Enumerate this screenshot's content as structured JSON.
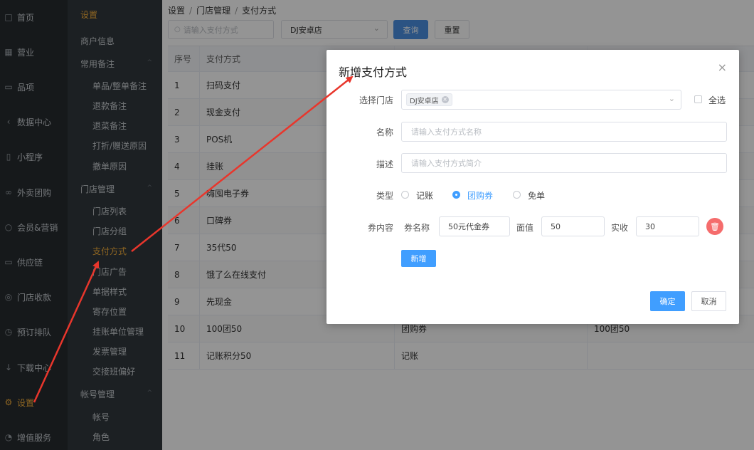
{
  "nav_primary": [
    {
      "icon": "home-icon",
      "glyph": "□",
      "label": "首页"
    },
    {
      "icon": "calendar-icon",
      "glyph": "▦",
      "label": "营业"
    },
    {
      "icon": "bag-icon",
      "glyph": "▭",
      "label": "品项"
    },
    {
      "icon": "share-icon",
      "glyph": "‹",
      "label": "数据中心"
    },
    {
      "icon": "phone-icon",
      "glyph": "▯",
      "label": "小程序"
    },
    {
      "icon": "bike-icon",
      "glyph": "∞",
      "label": "外卖团购"
    },
    {
      "icon": "user-icon",
      "glyph": "○",
      "label": "会员&营销"
    },
    {
      "icon": "truck-icon",
      "glyph": "▭",
      "label": "供应链"
    },
    {
      "icon": "database-icon",
      "glyph": "◎",
      "label": "门店收款"
    },
    {
      "icon": "clock-icon",
      "glyph": "◷",
      "label": "预订排队"
    },
    {
      "icon": "download-icon",
      "glyph": "↓",
      "label": "下载中心"
    },
    {
      "icon": "gear-icon",
      "glyph": "⚙",
      "label": "设置"
    },
    {
      "icon": "alarm-icon",
      "glyph": "◔",
      "label": "增值服务"
    }
  ],
  "nav_secondary": {
    "title": "设置",
    "items": [
      {
        "label": "商户信息",
        "level": 1
      },
      {
        "label": "常用备注",
        "level": 1,
        "caret": "^"
      },
      {
        "label": "单品/整单备注",
        "level": 2
      },
      {
        "label": "退款备注",
        "level": 2
      },
      {
        "label": "退菜备注",
        "level": 2
      },
      {
        "label": "打折/赠送原因",
        "level": 2
      },
      {
        "label": "撤单原因",
        "level": 2
      },
      {
        "label": "门店管理",
        "level": 1,
        "caret": "^"
      },
      {
        "label": "门店列表",
        "level": 2
      },
      {
        "label": "门店分组",
        "level": 2
      },
      {
        "label": "支付方式",
        "level": 2,
        "active": true
      },
      {
        "label": "门店广告",
        "level": 2
      },
      {
        "label": "单据样式",
        "level": 2
      },
      {
        "label": "寄存位置",
        "level": 2
      },
      {
        "label": "挂账单位管理",
        "level": 2
      },
      {
        "label": "发票管理",
        "level": 2
      },
      {
        "label": "交接班偏好",
        "level": 2
      },
      {
        "label": "帐号管理",
        "level": 1,
        "caret": "^"
      },
      {
        "label": "帐号",
        "level": 2
      },
      {
        "label": "角色",
        "level": 2
      }
    ]
  },
  "breadcrumb": [
    "设置",
    "门店管理",
    "支付方式"
  ],
  "toolbar": {
    "search_placeholder": "请输入支付方式",
    "store_value": "DJ安卓店",
    "query_label": "查询",
    "reset_label": "重置"
  },
  "table": {
    "headers": [
      "序号",
      "支付方式",
      "",
      ""
    ],
    "rows": [
      [
        "1",
        "扫码支付",
        "",
        ""
      ],
      [
        "2",
        "现金支付",
        "",
        ""
      ],
      [
        "3",
        "POS机",
        "",
        ""
      ],
      [
        "4",
        "挂账",
        "",
        ""
      ],
      [
        "5",
        "嗨囤电子券",
        "",
        ""
      ],
      [
        "6",
        "口碑券",
        "",
        ""
      ],
      [
        "7",
        "35代50",
        "",
        ""
      ],
      [
        "8",
        "饿了么在线支付",
        "",
        ""
      ],
      [
        "9",
        "先现金",
        "",
        ""
      ],
      [
        "10",
        "100团50",
        "团购券",
        "100团50"
      ],
      [
        "11",
        "记账积分50",
        "记账",
        ""
      ]
    ]
  },
  "dialog": {
    "title": "新增支付方式",
    "close_glyph": "×",
    "store_label": "选择门店",
    "store_tag": "DJ安卓店",
    "select_all_label": "全选",
    "name_label": "名称",
    "name_placeholder": "请输入支付方式名称",
    "desc_label": "描述",
    "desc_placeholder": "请输入支付方式简介",
    "type_label": "类型",
    "type_options": [
      {
        "label": "记账",
        "selected": false
      },
      {
        "label": "团购券",
        "selected": true
      },
      {
        "label": "免单",
        "selected": false
      }
    ],
    "coupon_label": "券内容",
    "coupon_name_label": "券名称",
    "coupon_name_value": "50元代金券",
    "face_label": "面值",
    "face_value": "50",
    "actual_label": "实收",
    "actual_value": "30",
    "add_label": "新增",
    "ok_label": "确定",
    "cancel_label": "取消"
  },
  "colors": {
    "accent": "#409eff",
    "active_nav": "#f6b03c",
    "danger": "#f56c6c",
    "annotation_arrow": "#e8362c"
  }
}
